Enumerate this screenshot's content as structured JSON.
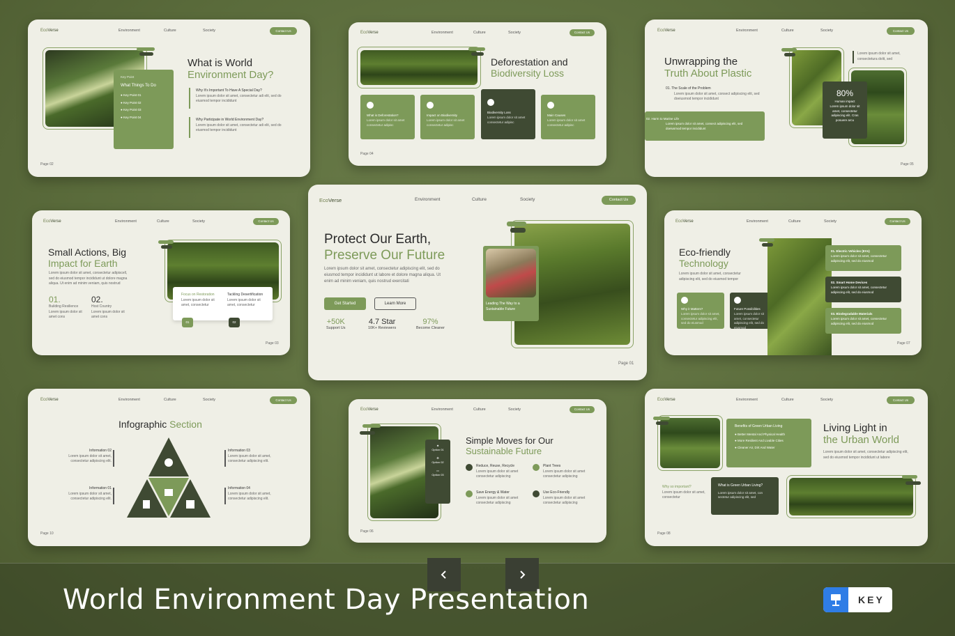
{
  "footer": {
    "title": "World Environment Day Presentation",
    "badge": "KEY",
    "prev_icon": "chevron-left-icon",
    "next_icon": "chevron-right-icon"
  },
  "nav": {
    "logo_a": "Eco",
    "logo_b": "Verse",
    "items": [
      "Environment",
      "Culture",
      "Society"
    ],
    "contact": "Contact Us"
  },
  "slide1": {
    "title_a": "What is World",
    "title_b": "Environment Day?",
    "key_point": "Key Point",
    "things": "What Things To Do",
    "points": [
      "Key Point 01",
      "Key Point 02",
      "Key Point 03",
      "Key Point 04"
    ],
    "q1": "Why It's Important To Have A Special Day?",
    "q2": "Why Participate in World Environment Day?",
    "lorem": "Lorem ipsum dolor sit amet, consectetur adi elit, sed do eiusmod tempor incididunt",
    "page": "Page 02"
  },
  "slide2": {
    "title_a": "Deforestation and",
    "title_b": "Biodiversity Loss",
    "boxes": [
      "What is Deforestation?",
      "Impact on Biodiversity",
      "Biodiversity Loss",
      "Main Causes"
    ],
    "lorem": "Lorem ipsum dolor sit amet consectetur adipisc",
    "page": "Page 04"
  },
  "slide3": {
    "title_a": "Unwrapping the",
    "title_b": "Truth About Plastic",
    "s1": "01.  The Scale of the Problem",
    "s2": "02.  Harm to Marine Life",
    "lorem": "Lorem ipsum dolor sit amet, consect adipiscing elit, sed doeiusmod tempor incididunt",
    "side": "Lorem ipsum dolor sit amet, consectetura dolit, sed",
    "stat": "80%",
    "stat_label": "Human impact",
    "stat_text": "Lorem ipsum dolor sit amet, consectetur adipiscing elit. Cras posuere arcu",
    "page": "Page 05"
  },
  "slide4": {
    "title_a": "Small Actions, Big",
    "title_b": "Impact for Earth",
    "lorem": "Lorem ipsum dolor sit amet, consectetur adipiscell, sed do eiusmod tempor incididunt ut dolore magna aliqua. Ut enim ad minim veniam, quis nostrud",
    "n1": "01.",
    "l1": "Building Resilience",
    "n2": "02.",
    "l2": "Host Country",
    "small": "Lorem ipsum dolor sit amet cons",
    "card1": "Focus on Restoration",
    "card2": "Tackling Desertification",
    "card_text": "Lorem ipsum dolor sit amet, consectetur",
    "tag1": "01",
    "tag2": "02",
    "page": "Page 03"
  },
  "slide5": {
    "title_a": "Protect Our Earth,",
    "title_b": "Preserve Our Future",
    "lorem": "Lorem ipsum dolor sit amet, consectetur adipiscing elit, sed do eiusmod tempor incididunt ut labore et dolore magna aliqua. Ut enim ad minim veniam, quis nostrud exercitati",
    "btn1": "Get Started",
    "btn2": "Learn More",
    "stats": [
      {
        "v": "+50K",
        "l": "Support Us"
      },
      {
        "v": "4.7 Star",
        "l": "10K+ Reviewers"
      },
      {
        "v": "97%",
        "l": "Become Cleaner"
      }
    ],
    "caption": "Leading The Way to a Sustainable Future",
    "page": "Page 01"
  },
  "slide6": {
    "title_a": "Eco-friendly",
    "title_b": "Technology",
    "lorem": "Lorem ipsum dolor sit amet, consectetur adipiscing elit, sed do eiusmod tempor",
    "b1": "Why it Matters?",
    "b2": "Future Possibilities",
    "items": [
      "01.  Electric Vehicles (EVs)",
      "02.  Smart Home Devices",
      "03.  Biodegradable Materials"
    ],
    "small": "Lorem ipsum dolor sit amet, consectetur adipiscing elit, sed do eiusmod",
    "page": "Page 07"
  },
  "slide7": {
    "title_a": "Infographic",
    "title_b": "Section",
    "infos": [
      "Information 02",
      "Information 03",
      "Information 01",
      "Information 04"
    ],
    "lorem": "Lorem ipsum dolor sit amet, consectetur adipiscing elit.",
    "page": "Page 10"
  },
  "slide8": {
    "title_a": "Simple Moves for Our",
    "title_b": "Sustainable Future",
    "options": [
      "Option 01",
      "Option 02",
      "Option 03"
    ],
    "items": [
      "Reduce, Reuse, Recycle",
      "Plant Trees",
      "Save Energy & Water",
      "Use Eco-Friendly"
    ],
    "lorem": "Lorem ipsum dolor sit amet consectetur adipiscing",
    "page": "Page 06"
  },
  "slide9": {
    "title_a": "Living Light in",
    "title_b": "the Urban World",
    "lorem": "Lorem ipsum dolor sit amet, consectetur adipiscing elit, sed do eiusmod tempor incididunt ut labore",
    "benefits": "Benefits of Green Urban Living",
    "bullets": [
      "Better Mental And Physical Health",
      "More Resilient And Livable Cities",
      "Cleaner Air, Dirt And Water"
    ],
    "why": "Why so important?",
    "why_text": "Lorem ipsum dolor sit amet, consectetur",
    "dark_title": "What is Green Urban Living?",
    "dark_text": "Lorem ipsum dolor sit amet, con sectetur adipiscing elit, sed",
    "page": "Page 08"
  }
}
